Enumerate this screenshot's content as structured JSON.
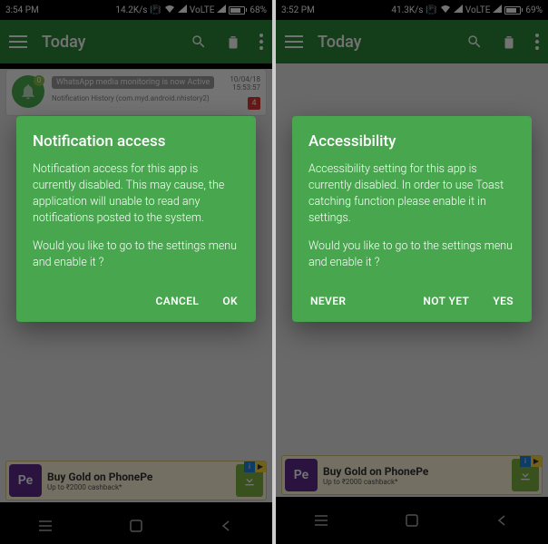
{
  "left": {
    "statusbar": {
      "time": "3:54 PM",
      "speed": "14.2K/s",
      "net_label": "VoLTE",
      "battery_pct": "68%"
    },
    "appbar": {
      "title": "Today"
    },
    "notif": {
      "title": "WhatsApp media monitoring is now Active",
      "sub": "Notification History (com.myd.android.nhistory2)",
      "date": "10/04/18",
      "time": "15:53:57",
      "count": "4",
      "badge": "0"
    },
    "dialog": {
      "title": "Notification access",
      "body1": "Notification access for this app is currently disabled. This may cause, the application will unable to read any notifications posted to the system.",
      "body2": "Would you like to go to the settings menu and enable it ?",
      "cancel": "CANCEL",
      "ok": "OK"
    },
    "ad": {
      "logo": "Pe",
      "title": "Buy Gold on PhonePe",
      "sub": "Up to ₹2000 cashback*"
    }
  },
  "right": {
    "statusbar": {
      "time": "3:52 PM",
      "speed": "41.3K/s",
      "net_label": "VoLTE",
      "battery_pct": "69%"
    },
    "appbar": {
      "title": "Today"
    },
    "dialog": {
      "title": "Accessibility",
      "body1": "Accessibility setting for this app is currently disabled. In order to use Toast catching function please enable it in settings.",
      "body2": "Would you like to go to the settings menu and enable it ?",
      "never": "NEVER",
      "notyet": "NOT YET",
      "yes": "YES"
    },
    "ad": {
      "logo": "Pe",
      "title": "Buy Gold on PhonePe",
      "sub": "Up to ₹2000 cashback*"
    }
  }
}
